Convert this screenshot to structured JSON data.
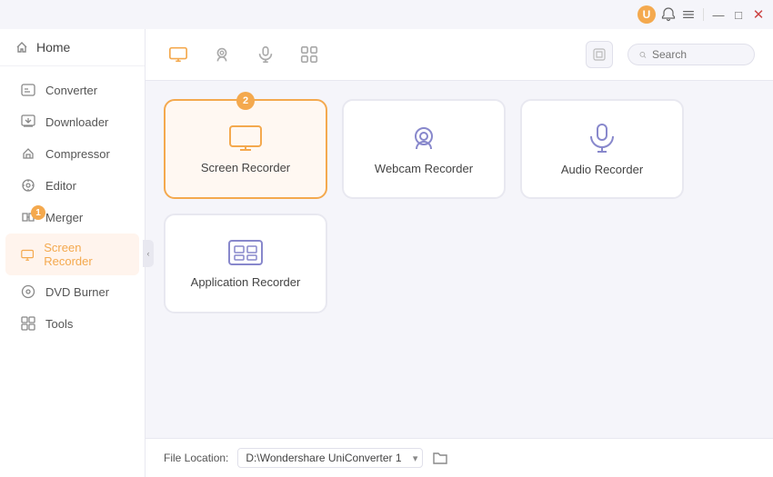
{
  "titleBar": {
    "userInitial": "U",
    "notificationLabel": "notifications",
    "menuLabel": "menu",
    "minimizeLabel": "minimize",
    "maximizeLabel": "maximize",
    "closeLabel": "close"
  },
  "sidebar": {
    "homeLabel": "Home",
    "items": [
      {
        "id": "converter",
        "label": "Converter",
        "active": false,
        "badge": null
      },
      {
        "id": "downloader",
        "label": "Downloader",
        "active": false,
        "badge": null
      },
      {
        "id": "compressor",
        "label": "Compressor",
        "active": false,
        "badge": null
      },
      {
        "id": "editor",
        "label": "Editor",
        "active": false,
        "badge": null
      },
      {
        "id": "merger",
        "label": "Merger",
        "active": false,
        "badge": "1"
      },
      {
        "id": "screen-recorder",
        "label": "Screen Recorder",
        "active": true,
        "badge": null
      },
      {
        "id": "dvd-burner",
        "label": "DVD Burner",
        "active": false,
        "badge": null
      },
      {
        "id": "tools",
        "label": "Tools",
        "active": false,
        "badge": null
      }
    ]
  },
  "toolbar": {
    "icons": [
      {
        "id": "monitor",
        "label": "screen-record-icon",
        "active": true
      },
      {
        "id": "webcam",
        "label": "webcam-icon",
        "active": false
      },
      {
        "id": "audio",
        "label": "audio-icon",
        "active": false
      },
      {
        "id": "apps",
        "label": "apps-icon",
        "active": false
      }
    ],
    "search": {
      "placeholder": "Search",
      "value": ""
    }
  },
  "cards": {
    "rows": [
      [
        {
          "id": "screen-recorder",
          "label": "Screen Recorder",
          "selected": true,
          "badge": "2"
        },
        {
          "id": "webcam-recorder",
          "label": "Webcam Recorder",
          "selected": false,
          "badge": null
        },
        {
          "id": "audio-recorder",
          "label": "Audio Recorder",
          "selected": false,
          "badge": null
        }
      ],
      [
        {
          "id": "application-recorder",
          "label": "Application Recorder",
          "selected": false,
          "badge": null
        }
      ]
    ]
  },
  "fileLocation": {
    "label": "File Location:",
    "path": "D:\\Wondershare UniConverter 1",
    "options": [
      "D:\\Wondershare UniConverter 1"
    ]
  },
  "colors": {
    "accent": "#f4a94e",
    "accentLight": "#fff8f2",
    "border": "#e8e8f0",
    "text": "#444"
  }
}
